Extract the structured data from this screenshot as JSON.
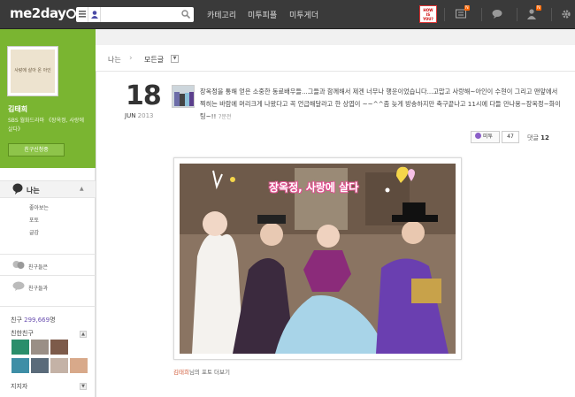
{
  "header": {
    "logo": "me2day",
    "nav": [
      "카테고리",
      "미투피플",
      "미투게더"
    ],
    "badge_lines": [
      "HOW",
      "IS",
      "YOU?"
    ],
    "counts": [
      "N",
      "N"
    ]
  },
  "profile": {
    "name": "김태희",
    "description": "SBS 월화드라마 《장옥정, 사랑에 살다》",
    "avatar_caption": "사랑에 살아 온 아인",
    "friend_request": "친구신청중"
  },
  "sidebar": {
    "me": "나는",
    "sub_items": [
      "좋아보는",
      "포토",
      "글감"
    ],
    "links": [
      "친구들은",
      "친구들과"
    ],
    "friend_count_label": "친구",
    "friend_count": "299,669",
    "friend_count_unit": "명",
    "close_friends": "친한친구",
    "supporters": "지지자"
  },
  "breadcrumb": {
    "home": "나는",
    "current": "모든글"
  },
  "post": {
    "day": "18",
    "month": "JUN",
    "year": "2013",
    "text": "장옥정을 통해 얻은 소중한 동료배우들...그들과 함께해서 제겐 너무나 행운이었습니다...고맙고 사랑해~아인이 수현이 그리고 맨앞에서 찍히는 바람에 머리크게 나왔다고 꼭 언급해달라고 한 상엽이 ~~^^좀 늦게 방송하지만 축구끝나고 11시에 다들 만나용~장옥정~화이팅~!!",
    "time_ago": "7분전",
    "metoo_label": "미투",
    "metoo_count": "47",
    "reply_label": "댓글",
    "reply_count": "12",
    "photo_title": "장옥정, 사랑에 살다",
    "photo_more_name": "김태희",
    "photo_more_suffix": "님의 포토 더보기"
  },
  "colors": {
    "topbar": "#3a3a3a",
    "profile_green": "#7ab531",
    "accent_purple": "#6a4fb0",
    "title_pink": "#e0508f"
  }
}
